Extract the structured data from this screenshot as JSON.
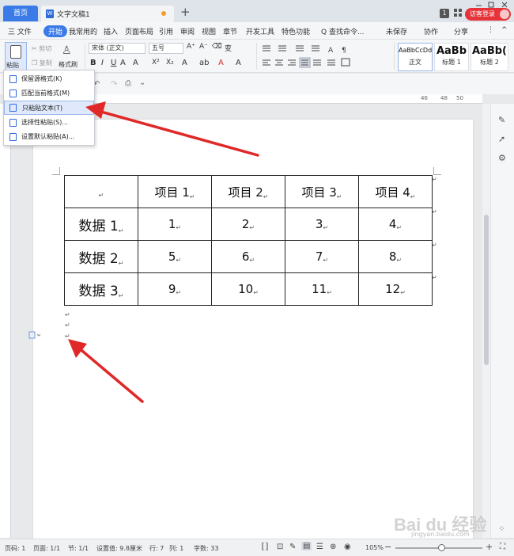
{
  "titlebar": {
    "home_tab": "首页",
    "doc_tab": "文字文稿1",
    "new_tab": "+",
    "badge_num": "1",
    "visitor_label": "访客登录"
  },
  "menubar": {
    "file": "三 文件",
    "items": [
      "开始",
      "我常用的",
      "插入",
      "页面布局",
      "引用",
      "审阅",
      "视图",
      "章节",
      "开发工具",
      "特色功能"
    ],
    "search": "Q 查找命令...",
    "right": [
      "未保存",
      "协作",
      "分享"
    ]
  },
  "ribbon": {
    "paste": "粘贴",
    "cut": "剪切",
    "copy": "复制",
    "format_painter": "格式刷",
    "font_name": "宋体 (正文)",
    "font_size": "五号",
    "styles": [
      {
        "sample": "AaBbCcDd",
        "name": "正文"
      },
      {
        "sample": "AaBb",
        "name": "标题 1"
      },
      {
        "sample": "AaBb(",
        "name": "标题 2"
      }
    ]
  },
  "paste_menu": {
    "items": [
      "保留源格式(K)",
      "匹配当前格式(M)",
      "只粘贴文本(T)",
      "选择性粘贴(S)...",
      "设置默认粘贴(A)..."
    ],
    "highlighted_index": 2
  },
  "ruler": {
    "labels": [
      "46",
      "48",
      "50"
    ]
  },
  "table": {
    "header": [
      "",
      "项目 1",
      "项目 2",
      "项目 3",
      "项目 4"
    ],
    "rows": [
      [
        "数据 1",
        "1",
        "2",
        "3",
        "4"
      ],
      [
        "数据 2",
        "5",
        "6",
        "7",
        "8"
      ],
      [
        "数据 3",
        "9",
        "10",
        "11",
        "12"
      ]
    ]
  },
  "statusbar": {
    "page_num": "页码: 1",
    "pages": "页面: 1/1",
    "section": "节: 1/1",
    "setting": "设置值: 9.8厘米",
    "row": "行: 7",
    "col": "列: 1",
    "words": "字数: 33",
    "zoom": "105%"
  },
  "watermark": {
    "text": "Bai du 经验",
    "sub": "jingyan.baidu.com"
  },
  "colors": {
    "accent": "#3a7be8",
    "arrow": "#e02828",
    "visitor": "#e6333a"
  }
}
